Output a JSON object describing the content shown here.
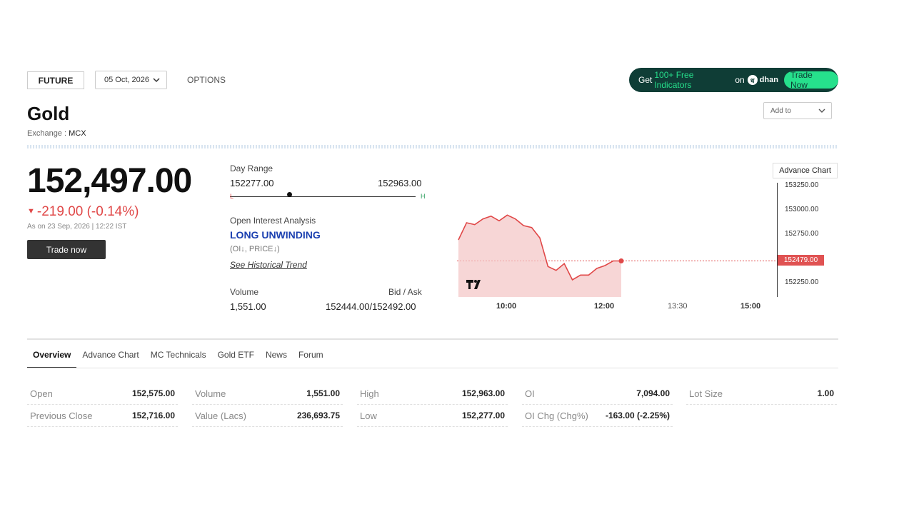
{
  "top": {
    "tab_future": "FUTURE",
    "expiry": "05 Oct, 2026",
    "tab_options": "OPTIONS",
    "promo": {
      "get": "Get",
      "highlight": "100+ Free Indicators",
      "on": "on",
      "brand": "dhan",
      "button": "Trade Now"
    }
  },
  "instrument": {
    "name": "Gold",
    "exchange_label": "Exchange :",
    "exchange": "MCX",
    "add_to": "Add to"
  },
  "quote": {
    "price": "152,497.00",
    "change": "-219.00 (-0.14%)",
    "as_of": "As on 23 Sep, 2026 | 12:22 IST",
    "trade_now": "Trade now"
  },
  "day_range": {
    "label": "Day Range",
    "low": "152277.00",
    "high": "152963.00",
    "l": "L",
    "h": "H",
    "current_fraction": 0.32
  },
  "oi": {
    "label": "Open Interest Analysis",
    "signal": "LONG UNWINDING",
    "sub": "(OI↓, PRICE↓)",
    "link": "See Historical Trend"
  },
  "volume": {
    "label": "Volume",
    "value": "1,551.00"
  },
  "bid_ask": {
    "label": "Bid / Ask",
    "value": "152444.00/152492.00"
  },
  "chart": {
    "advance_button": "Advance Chart",
    "logo": "TV",
    "y_ticks": [
      "153250.00",
      "153000.00",
      "152750.00",
      "152250.00"
    ],
    "last": "152479.00",
    "x_ticks": [
      "10:00",
      "12:00",
      "13:30",
      "15:00"
    ]
  },
  "chart_data": {
    "type": "area",
    "x": [
      "09:00",
      "09:10",
      "09:20",
      "09:30",
      "09:40",
      "09:50",
      "10:00",
      "10:10",
      "10:20",
      "10:30",
      "10:40",
      "10:50",
      "11:00",
      "11:10",
      "11:20",
      "11:30",
      "11:40",
      "11:50",
      "12:00",
      "12:10",
      "12:20"
    ],
    "series": [
      {
        "values": [
          152700,
          152880,
          152860,
          152920,
          152950,
          152900,
          152960,
          152920,
          152850,
          152830,
          152720,
          152420,
          152380,
          152450,
          152280,
          152330,
          152330,
          152400,
          152430,
          152479,
          152479
        ]
      }
    ],
    "ylim": [
      152100,
      153300
    ],
    "last_value": 152479
  },
  "tabs": [
    "Overview",
    "Advance Chart",
    "MC Technicals",
    "Gold ETF",
    "News",
    "Forum"
  ],
  "stats": [
    [
      {
        "k": "Open",
        "v": "152,575.00"
      },
      {
        "k": "Previous Close",
        "v": "152,716.00"
      }
    ],
    [
      {
        "k": "Volume",
        "v": "1,551.00"
      },
      {
        "k": "Value (Lacs)",
        "v": "236,693.75"
      }
    ],
    [
      {
        "k": "High",
        "v": "152,963.00"
      },
      {
        "k": "Low",
        "v": "152,277.00"
      }
    ],
    [
      {
        "k": "OI",
        "v": "7,094.00"
      },
      {
        "k": "OI Chg (Chg%)",
        "v": "-163.00 (-2.25%)"
      }
    ],
    [
      {
        "k": "Lot Size",
        "v": "1.00"
      }
    ]
  ],
  "colors": {
    "negative": "#e04848",
    "promo_bg": "#0f3d36",
    "promo_accent": "#26e08c",
    "signal": "#1a3fb0"
  }
}
